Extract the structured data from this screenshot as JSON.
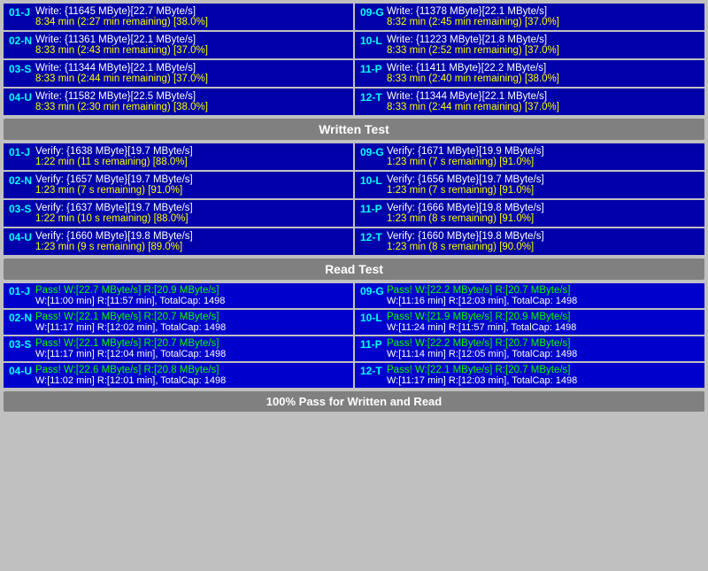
{
  "sections": {
    "write": {
      "header": "Written Test",
      "cells": [
        {
          "id": "01-J",
          "line1": "Write: {11645 MByte}[22.7 MByte/s]",
          "line2": "8:34 min (2:27 min remaining)  [38.0%]",
          "col": "left"
        },
        {
          "id": "09-G",
          "line1": "Write: {11378 MByte}[22.1 MByte/s]",
          "line2": "8:32 min (2:45 min remaining)  [37.0%]",
          "col": "right"
        },
        {
          "id": "02-N",
          "line1": "Write: {11361 MByte}[22.1 MByte/s]",
          "line2": "8:33 min (2:43 min remaining)  [37.0%]",
          "col": "left"
        },
        {
          "id": "10-L",
          "line1": "Write: {11223 MByte}[21.8 MByte/s]",
          "line2": "8:33 min (2:52 min remaining)  [37.0%]",
          "col": "right"
        },
        {
          "id": "03-S",
          "line1": "Write: {11344 MByte}[22.1 MByte/s]",
          "line2": "8:33 min (2:44 min remaining)  [37.0%]",
          "col": "left"
        },
        {
          "id": "11-P",
          "line1": "Write: {11411 MByte}[22.2 MByte/s]",
          "line2": "8:33 min (2:40 min remaining)  [38.0%]",
          "col": "right"
        },
        {
          "id": "04-U",
          "line1": "Write: {11582 MByte}[22.5 MByte/s]",
          "line2": "8:33 min (2:30 min remaining)  [38.0%]",
          "col": "left"
        },
        {
          "id": "12-T",
          "line1": "Write: {11344 MByte}[22.1 MByte/s]",
          "line2": "8:33 min (2:44 min remaining)  [37.0%]",
          "col": "right"
        }
      ]
    },
    "verify": {
      "header": "Written Test",
      "cells": [
        {
          "id": "01-J",
          "line1": "Verify: {1638 MByte}[19.7 MByte/s]",
          "line2": "1:22 min (11 s remaining)  [88.0%]",
          "col": "left"
        },
        {
          "id": "09-G",
          "line1": "Verify: {1671 MByte}[19.9 MByte/s]",
          "line2": "1:23 min (7 s remaining)  [91.0%]",
          "col": "right"
        },
        {
          "id": "02-N",
          "line1": "Verify: {1657 MByte}[19.7 MByte/s]",
          "line2": "1:23 min (7 s remaining)  [91.0%]",
          "col": "left"
        },
        {
          "id": "10-L",
          "line1": "Verify: {1656 MByte}[19.7 MByte/s]",
          "line2": "1:23 min (7 s remaining)  [91.0%]",
          "col": "right"
        },
        {
          "id": "03-S",
          "line1": "Verify: {1637 MByte}[19.7 MByte/s]",
          "line2": "1:22 min (10 s remaining)  [88.0%]",
          "col": "left"
        },
        {
          "id": "11-P",
          "line1": "Verify: {1666 MByte}[19.8 MByte/s]",
          "line2": "1:23 min (8 s remaining)  [91.0%]",
          "col": "right"
        },
        {
          "id": "04-U",
          "line1": "Verify: {1660 MByte}[19.8 MByte/s]",
          "line2": "1:23 min (9 s remaining)  [89.0%]",
          "col": "left"
        },
        {
          "id": "12-T",
          "line1": "Verify: {1660 MByte}[19.8 MByte/s]",
          "line2": "1:23 min (8 s remaining)  [90.0%]",
          "col": "right"
        }
      ]
    },
    "read": {
      "header": "Read Test",
      "cells": [
        {
          "id": "01-J",
          "line1": "Pass! W:[22.7 MByte/s] R:[20.9 MByte/s]",
          "line2": "W:[11:00 min] R:[11:57 min], TotalCap: 1498",
          "col": "left"
        },
        {
          "id": "09-G",
          "line1": "Pass! W:[22.2 MByte/s] R:[20.7 MByte/s]",
          "line2": "W:[11:16 min] R:[12:03 min], TotalCap: 1498",
          "col": "right"
        },
        {
          "id": "02-N",
          "line1": "Pass! W:[22.1 MByte/s] R:[20.7 MByte/s]",
          "line2": "W:[11:17 min] R:[12:02 min], TotalCap: 1498",
          "col": "left"
        },
        {
          "id": "10-L",
          "line1": "Pass! W:[21.9 MByte/s] R:[20.9 MByte/s]",
          "line2": "W:[11:24 min] R:[11:57 min], TotalCap: 1498",
          "col": "right"
        },
        {
          "id": "03-S",
          "line1": "Pass! W:[22.1 MByte/s] R:[20.7 MByte/s]",
          "line2": "W:[11:17 min] R:[12:04 min], TotalCap: 1498",
          "col": "left"
        },
        {
          "id": "11-P",
          "line1": "Pass! W:[22.2 MByte/s] R:[20.7 MByte/s]",
          "line2": "W:[11:14 min] R:[12:05 min], TotalCap: 1498",
          "col": "right"
        },
        {
          "id": "04-U",
          "line1": "Pass! W:[22.6 MByte/s] R:[20.8 MByte/s]",
          "line2": "W:[11:02 min] R:[12:01 min], TotalCap: 1498",
          "col": "left"
        },
        {
          "id": "12-T",
          "line1": "Pass! W:[22.1 MByte/s] R:[20.7 MByte/s]",
          "line2": "W:[11:17 min] R:[12:03 min], TotalCap: 1498",
          "col": "right"
        }
      ]
    }
  },
  "headers": {
    "written_test": "Written Test",
    "read_test": "Read Test"
  },
  "footer": "100% Pass for Written and Read"
}
